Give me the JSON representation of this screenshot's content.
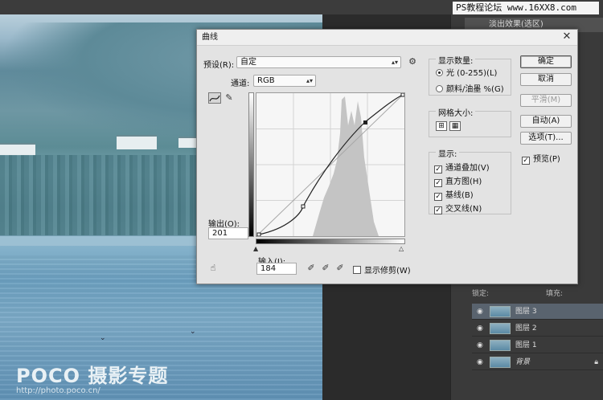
{
  "top_badge": "PS教程论坛 www.16XX8.com",
  "history_item": "淡出效果(选区)",
  "watermark": {
    "logo": "POCO 摄影专题",
    "url": "http://photo.poco.cn/"
  },
  "dialog": {
    "title": "曲线",
    "preset_label": "预设(R):",
    "preset_value": "自定",
    "channel_label": "通道:",
    "channel_value": "RGB",
    "output_label": "输出(O):",
    "output_value": "201",
    "input_label": "输入(I):",
    "input_value": "184",
    "show_clipping": "显示修剪(W)",
    "display_amount": {
      "title": "显示数量:",
      "light": "光 (0-255)(L)",
      "pigment": "颜料/油墨 %(G)"
    },
    "grid_size_title": "网格大小:",
    "show": {
      "title": "显示:",
      "items": [
        "通道叠加(V)",
        "直方图(H)",
        "基线(B)",
        "交叉线(N)"
      ]
    },
    "buttons": {
      "ok": "确定",
      "cancel": "取消",
      "smooth": "平滑(M)",
      "auto": "自动(A)",
      "options": "选项(T)...",
      "preview": "预览(P)"
    }
  },
  "layers_panel": {
    "lock_label": "锁定:",
    "fill_label": "填充:",
    "layers": [
      {
        "name": "图层 3",
        "selected": true
      },
      {
        "name": "图层 2",
        "selected": false
      },
      {
        "name": "图层 1",
        "selected": false
      },
      {
        "name": "背景",
        "selected": false,
        "locked": true
      }
    ]
  }
}
